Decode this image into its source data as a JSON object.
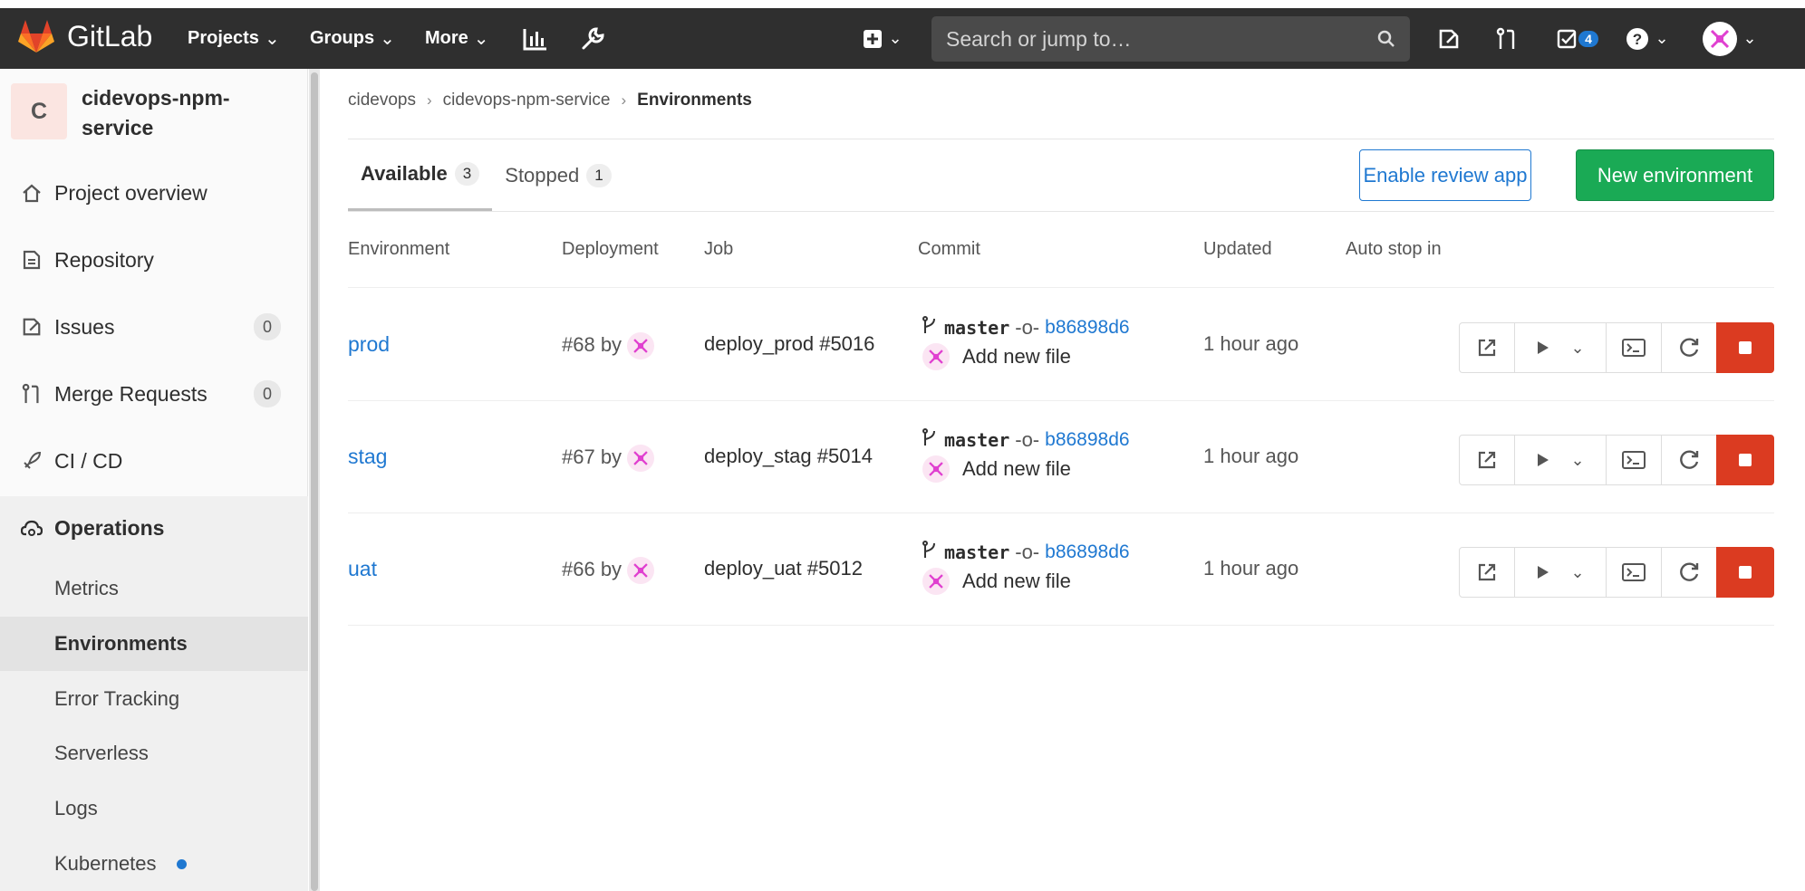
{
  "navbar": {
    "brand": "GitLab",
    "menus": [
      {
        "label": "Projects"
      },
      {
        "label": "Groups"
      },
      {
        "label": "More"
      }
    ],
    "search_placeholder": "Search or jump to…",
    "todos_count": "4"
  },
  "project": {
    "avatar_letter": "C",
    "name": "cidevops-npm-service"
  },
  "sidebar": {
    "items": [
      {
        "label": "Project overview"
      },
      {
        "label": "Repository"
      },
      {
        "label": "Issues",
        "count": "0"
      },
      {
        "label": "Merge Requests",
        "count": "0"
      },
      {
        "label": "CI / CD"
      },
      {
        "label": "Operations"
      }
    ],
    "operations_sub": [
      {
        "label": "Metrics"
      },
      {
        "label": "Environments"
      },
      {
        "label": "Error Tracking"
      },
      {
        "label": "Serverless"
      },
      {
        "label": "Logs"
      },
      {
        "label": "Kubernetes"
      }
    ]
  },
  "breadcrumb": [
    "cidevops",
    "cidevops-npm-service",
    "Environments"
  ],
  "tabs": [
    {
      "label": "Available",
      "count": "3"
    },
    {
      "label": "Stopped",
      "count": "1"
    }
  ],
  "buttons": {
    "review": "Enable review app",
    "new_env": "New environment"
  },
  "table": {
    "headers": [
      "Environment",
      "Deployment",
      "Job",
      "Commit",
      "Updated",
      "Auto stop in"
    ],
    "rows": [
      {
        "env": "prod",
        "deployment": "#68 by",
        "job": "deploy_prod #5016",
        "ref": "master",
        "sha": "b86898d6",
        "message": "Add new file",
        "updated": "1 hour ago"
      },
      {
        "env": "stag",
        "deployment": "#67 by",
        "job": "deploy_stag #5014",
        "ref": "master",
        "sha": "b86898d6",
        "message": "Add new file",
        "updated": "1 hour ago"
      },
      {
        "env": "uat",
        "deployment": "#66 by",
        "job": "deploy_uat #5012",
        "ref": "master",
        "sha": "b86898d6",
        "message": "Add new file",
        "updated": "1 hour ago"
      }
    ]
  },
  "colors": {
    "navbar": "#2f2f2f",
    "link": "#1f78d1",
    "success": "#1aaa55",
    "danger": "#db3b21"
  }
}
